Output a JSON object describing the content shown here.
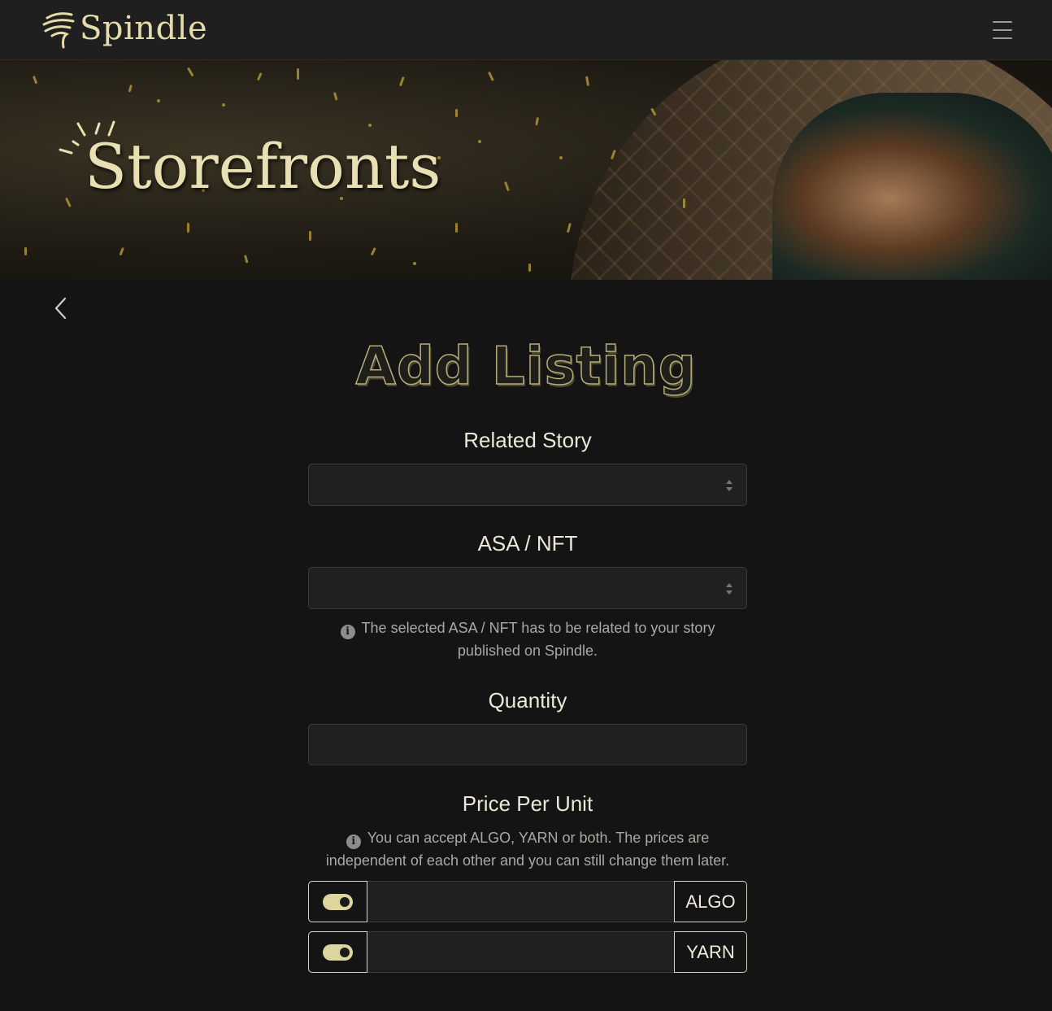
{
  "app": {
    "name": "Spindle"
  },
  "hero": {
    "title": "Storefronts"
  },
  "form": {
    "title": "Add Listing",
    "related_story": {
      "label": "Related Story",
      "value": ""
    },
    "asa_nft": {
      "label": "ASA / NFT",
      "value": "",
      "hint": "The selected ASA / NFT has to be related to your story published on Spindle."
    },
    "quantity": {
      "label": "Quantity",
      "value": ""
    },
    "price": {
      "label": "Price Per Unit",
      "hint": "You can accept ALGO, YARN or both. The prices are independent of each other and you can still change them later.",
      "rows": [
        {
          "currency": "ALGO",
          "enabled": true,
          "value": ""
        },
        {
          "currency": "YARN",
          "enabled": true,
          "value": ""
        }
      ]
    }
  },
  "colors": {
    "accent": "#dcd59e",
    "background": "#141414",
    "navbar": "#1f1f1f"
  },
  "icons": {
    "menu": "hamburger-icon",
    "back": "chevron-left-icon",
    "info": "info-icon"
  }
}
